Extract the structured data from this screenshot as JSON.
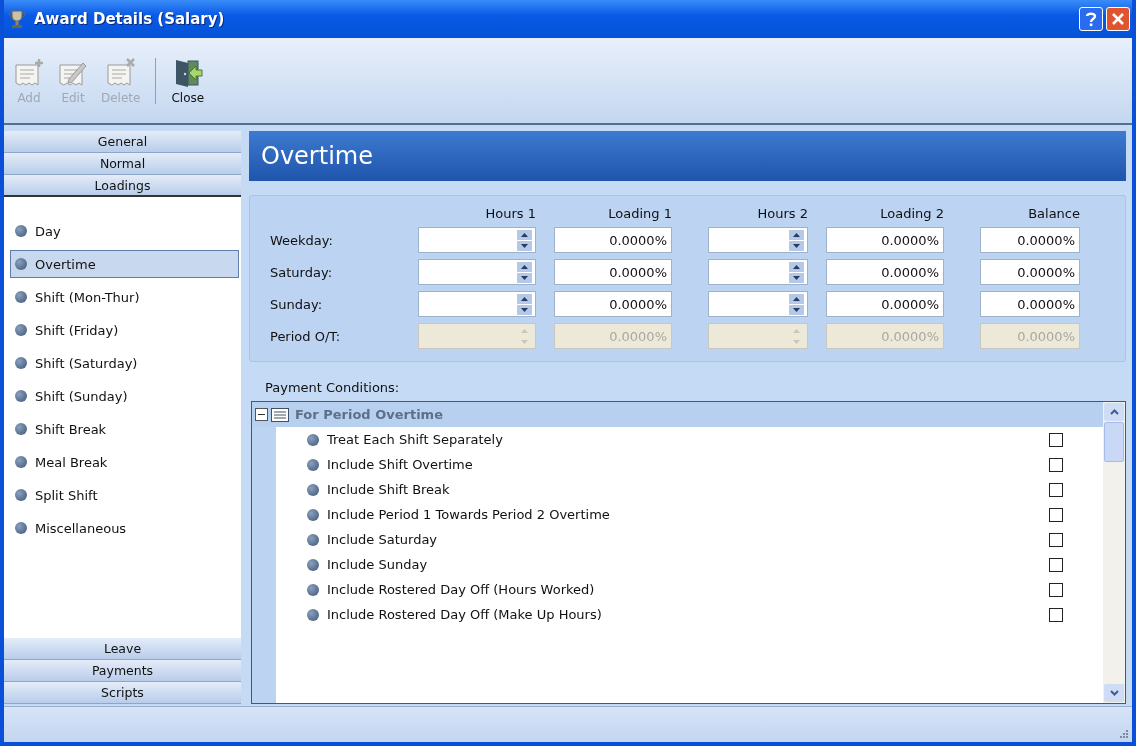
{
  "window": {
    "title": "Award Details (Salary)"
  },
  "toolbar": {
    "buttons": [
      {
        "label": "Add",
        "kind": "add",
        "disabled": true
      },
      {
        "label": "Edit",
        "kind": "edit",
        "disabled": true
      },
      {
        "label": "Delete",
        "kind": "delete",
        "disabled": true
      },
      {
        "label": "Close",
        "kind": "close",
        "disabled": false
      }
    ]
  },
  "sidebar": {
    "top_tabs": [
      {
        "label": "General",
        "selected": false
      },
      {
        "label": "Normal",
        "selected": false
      },
      {
        "label": "Loadings",
        "selected": true
      }
    ],
    "items": [
      {
        "label": "Day",
        "selected": false
      },
      {
        "label": "Overtime",
        "selected": true
      },
      {
        "label": "Shift (Mon-Thur)",
        "selected": false
      },
      {
        "label": "Shift (Friday)",
        "selected": false
      },
      {
        "label": "Shift (Saturday)",
        "selected": false
      },
      {
        "label": "Shift (Sunday)",
        "selected": false
      },
      {
        "label": "Shift Break",
        "selected": false
      },
      {
        "label": "Meal Break",
        "selected": false
      },
      {
        "label": "Split Shift",
        "selected": false
      },
      {
        "label": "Miscellaneous",
        "selected": false
      }
    ],
    "bottom_tabs": [
      {
        "label": "Leave",
        "selected": false
      },
      {
        "label": "Payments",
        "selected": false
      },
      {
        "label": "Scripts",
        "selected": false
      }
    ]
  },
  "content": {
    "heading": "Overtime",
    "columns": [
      "Hours 1",
      "Loading 1",
      "Hours 2",
      "Loading 2",
      "Balance"
    ],
    "rows": [
      {
        "label": "Weekday:",
        "disabled": false,
        "loading_1": "0.0000%",
        "loading_2": "0.0000%",
        "balance": "0.0000%"
      },
      {
        "label": "Saturday:",
        "disabled": false,
        "loading_1": "0.0000%",
        "loading_2": "0.0000%",
        "balance": "0.0000%"
      },
      {
        "label": "Sunday:",
        "disabled": false,
        "loading_1": "0.0000%",
        "loading_2": "0.0000%",
        "balance": "0.0000%"
      },
      {
        "label": "Period O/T:",
        "disabled": true,
        "loading_1": "0.0000%",
        "loading_2": "0.0000%",
        "balance": "0.0000%"
      }
    ],
    "conditions": {
      "label": "Payment Conditions:",
      "group": {
        "title": "For Period Overtime",
        "expanded": true,
        "disabled": true
      },
      "items": [
        {
          "label": "Treat Each Shift Separately",
          "checked": false
        },
        {
          "label": "Include Shift Overtime",
          "checked": false
        },
        {
          "label": "Include Shift Break",
          "checked": false
        },
        {
          "label": "Include Period 1 Towards Period 2 Overtime",
          "checked": false
        },
        {
          "label": "Include Saturday",
          "checked": false
        },
        {
          "label": "Include Sunday",
          "checked": false
        },
        {
          "label": "Include Rostered Day Off (Hours Worked)",
          "checked": false
        },
        {
          "label": "Include Rostered Day Off (Make Up Hours)",
          "checked": false
        }
      ]
    }
  }
}
